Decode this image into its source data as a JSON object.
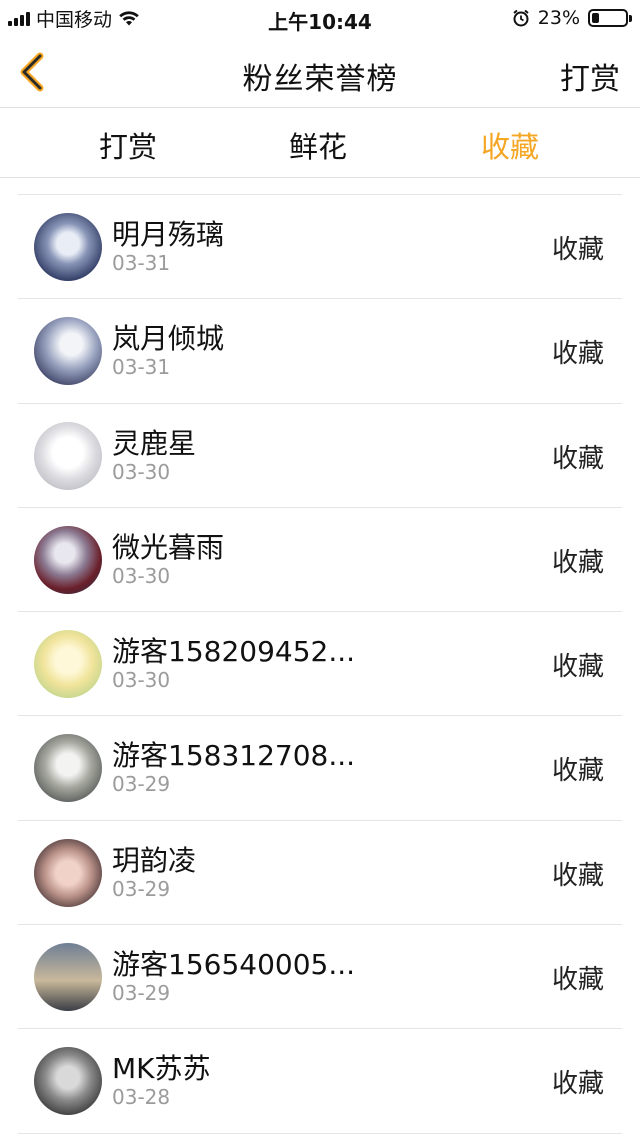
{
  "status_bar": {
    "carrier": "中国移动",
    "time": "上午10:44",
    "battery_text": "23%",
    "battery_level": 0.23
  },
  "header": {
    "title": "粉丝荣誉榜",
    "right_action": "打赏"
  },
  "tabs": [
    {
      "label": "打赏",
      "active": false
    },
    {
      "label": "鲜花",
      "active": false
    },
    {
      "label": "收藏",
      "active": true
    }
  ],
  "colors": {
    "accent": "#f5a623",
    "muted_text": "#9b9b9b",
    "divider": "#e5e5e5"
  },
  "items": [
    {
      "name": "明月殇璃",
      "date": "03-31",
      "action": "收藏",
      "avatar": "avatar-icon"
    },
    {
      "name": "岚月倾城",
      "date": "03-31",
      "action": "收藏",
      "avatar": "avatar-icon"
    },
    {
      "name": "灵鹿星",
      "date": "03-30",
      "action": "收藏",
      "avatar": "avatar-icon"
    },
    {
      "name": "微光暮雨",
      "date": "03-30",
      "action": "收藏",
      "avatar": "avatar-icon"
    },
    {
      "name": "游客158209452...",
      "date": "03-30",
      "action": "收藏",
      "avatar": "avatar-icon"
    },
    {
      "name": "游客158312708...",
      "date": "03-29",
      "action": "收藏",
      "avatar": "avatar-icon"
    },
    {
      "name": "玥韵凌",
      "date": "03-29",
      "action": "收藏",
      "avatar": "avatar-icon"
    },
    {
      "name": "游客156540005...",
      "date": "03-29",
      "action": "收藏",
      "avatar": "avatar-icon"
    },
    {
      "name": "MK苏苏",
      "date": "03-28",
      "action": "收藏",
      "avatar": "avatar-icon"
    }
  ]
}
